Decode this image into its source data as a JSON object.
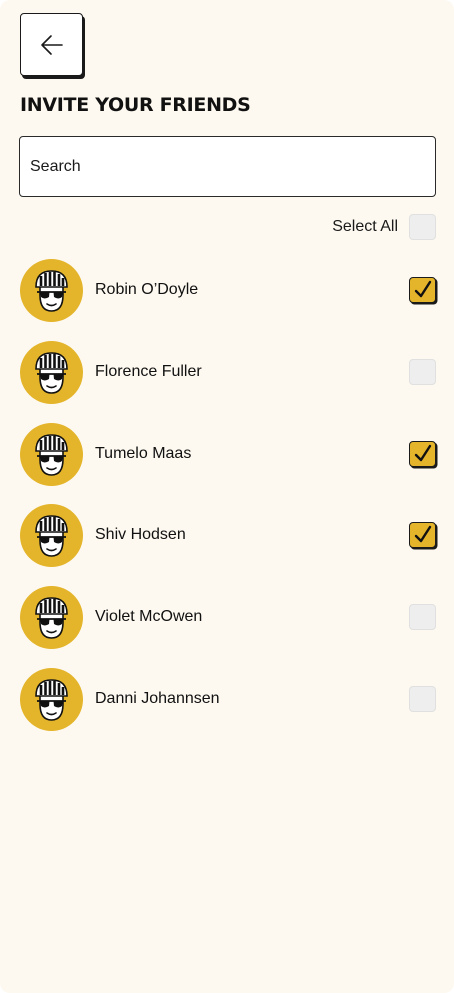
{
  "header": {
    "back_icon": "arrow-left-icon",
    "title": "INVITE YOUR FRIENDS"
  },
  "search": {
    "placeholder": "Search",
    "value": ""
  },
  "select_all": {
    "label": "Select All",
    "checked": false
  },
  "friends": [
    {
      "name": "Robin O’Doyle",
      "checked": true
    },
    {
      "name": "Florence Fuller",
      "checked": false
    },
    {
      "name": "Tumelo Maas",
      "checked": true
    },
    {
      "name": "Shiv Hodsen",
      "checked": true
    },
    {
      "name": "Violet McOwen",
      "checked": false
    },
    {
      "name": "Danni Johannsen",
      "checked": false
    }
  ],
  "avatar_icon": "cyclist-helmet-sunglasses-icon",
  "colors": {
    "background": "#fdf9f0",
    "accent": "#e4b42a",
    "text": "#111111",
    "checkbox_unchecked": "#eeeeee"
  }
}
